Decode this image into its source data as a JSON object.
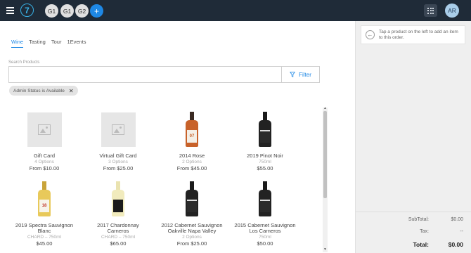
{
  "topbar": {
    "logo_text": "7",
    "guests": [
      "G1",
      "G1",
      "G2"
    ],
    "add_label": "+",
    "avatar": "AR"
  },
  "tabs": [
    "Wine",
    "Tasting",
    "Tour",
    "1Events"
  ],
  "search": {
    "label": "Search Products",
    "value": "",
    "placeholder": ""
  },
  "filter_label": "Filter",
  "chip": {
    "label": "Admin Status is Available",
    "close": "✕"
  },
  "products": [
    {
      "name": "Gift Card",
      "sub": "4 Options",
      "price": "From $10.00"
    },
    {
      "name": "Virtual Gift Card",
      "sub": "3 Options",
      "price": "From $25.00"
    },
    {
      "name": "2014 Rose",
      "sub": "2 Options",
      "price": "From $45.00",
      "label_text": "07"
    },
    {
      "name": "2019 Pinot Noir",
      "sub": "750ml",
      "price": "$55.00"
    },
    {
      "name": "2019 Spectra Sauvignon Blanc",
      "sub": "CHARD – 750ml",
      "price": "$45.00",
      "label_text": "18"
    },
    {
      "name": "2017 Chardonnay Carneros",
      "sub": "CHARD – 750ml",
      "price": "$65.00"
    },
    {
      "name": "2012 Cabernet Sauvignon Oakville Napa Valley",
      "sub": "2 Options",
      "price": "From $25.00"
    },
    {
      "name": "2015 Cabernet Sauvignon Los Carneros",
      "sub": "750ml",
      "price": "$50.00"
    }
  ],
  "cart": {
    "hint": "Tap a product on the left to add an item to this order.",
    "subtotal_label": "SubTotal:",
    "subtotal_value": "$0.00",
    "tax_label": "Tax:",
    "tax_value": "--",
    "total_label": "Total:",
    "total_value": "$0.00"
  },
  "colors": {
    "topbar": "#1f2b38",
    "accent": "#1e88e5"
  }
}
